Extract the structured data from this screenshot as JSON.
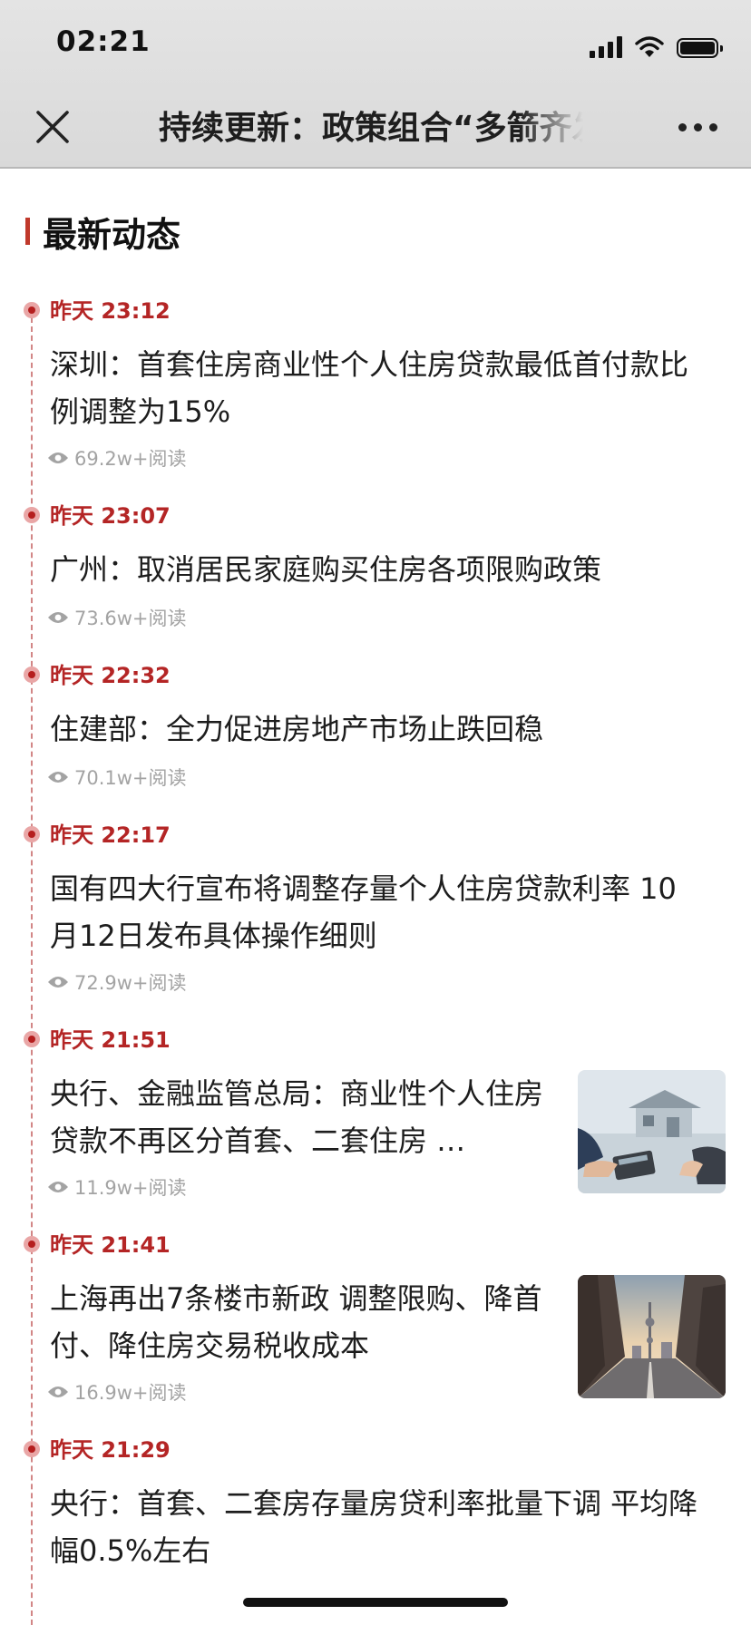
{
  "status_bar": {
    "time": "02:21"
  },
  "nav": {
    "title": "持续更新：政策组合“多箭齐发"
  },
  "section": {
    "title": "最新动态"
  },
  "feed": [
    {
      "time": "昨天 23:12",
      "title": "深圳：首套住房商业性个人住房贷款最低首付款比例调整为15%",
      "reads": "69.2w+阅读"
    },
    {
      "time": "昨天 23:07",
      "title": "广州：取消居民家庭购买住房各项限购政策",
      "reads": "73.6w+阅读"
    },
    {
      "time": "昨天 22:32",
      "title": "住建部：全力促进房地产市场止跌回稳",
      "reads": "70.1w+阅读"
    },
    {
      "time": "昨天 22:17",
      "title": "国有四大行宣布将调整存量个人住房贷款利率 10月12日发布具体操作细则",
      "reads": "72.9w+阅读"
    },
    {
      "time": "昨天 21:51",
      "title": "央行、金融监管总局：商业性个人住房贷款不再区分首套、二套住房 …",
      "reads": "11.9w+阅读",
      "thumbnail": "house-model-calculator-photo"
    },
    {
      "time": "昨天 21:41",
      "title": "上海再出7条楼市新政 调整限购、降首付、降住房交易税收成本",
      "reads": "16.9w+阅读",
      "thumbnail": "city-street-tower-photo"
    },
    {
      "time": "昨天 21:29",
      "title": "央行：首套、二套房存量房贷利率批量下调 平均降幅0.5%左右"
    }
  ],
  "colors": {
    "accent": "#b42525",
    "timeline": "#d28686",
    "muted": "#a3a3a3"
  },
  "icons": {
    "close": "close-icon",
    "more": "more-icon",
    "views": "eye-icon"
  }
}
